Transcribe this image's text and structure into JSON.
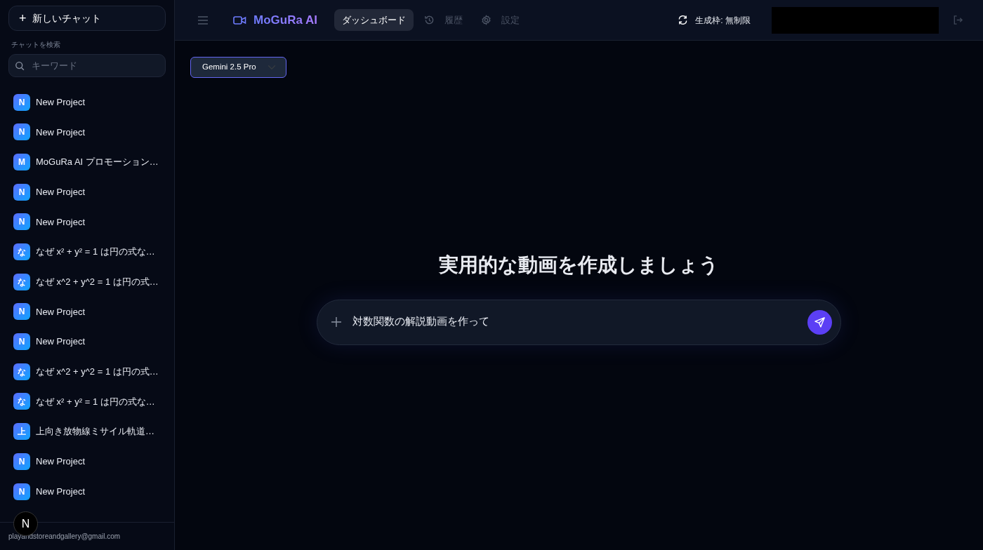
{
  "sidebar": {
    "new_chat_button": {
      "icon": "+",
      "label": "新しいチャット"
    },
    "search_label": "チャットを検索",
    "search": {
      "placeholder": "キーワード"
    },
    "chats": [
      {
        "initial": "N",
        "title": "New Project"
      },
      {
        "initial": "N",
        "title": "New Project"
      },
      {
        "initial": "M",
        "title": "MoGuRa AI プロモーション…"
      },
      {
        "initial": "N",
        "title": "New Project"
      },
      {
        "initial": "N",
        "title": "New Project"
      },
      {
        "initial": "な",
        "title": "なぜ x² + y² = 1 は円の式な…"
      },
      {
        "initial": "な",
        "title": "なぜ x^2 + y^2 = 1 は円の式…"
      },
      {
        "initial": "N",
        "title": "New Project"
      },
      {
        "initial": "N",
        "title": "New Project"
      },
      {
        "initial": "な",
        "title": "なぜ x^2 + y^2 = 1 は円の式…"
      },
      {
        "initial": "な",
        "title": "なぜ x² + y² = 1 は円の式な…"
      },
      {
        "initial": "上",
        "title": "上向き放物線ミサイル軌道…"
      },
      {
        "initial": "N",
        "title": "New Project"
      },
      {
        "initial": "N",
        "title": "New Project"
      }
    ],
    "dev_badge": "N",
    "email": "playandstoreandgallery@gmail.com"
  },
  "header": {
    "brand": "MoGuRa AI",
    "nav": [
      {
        "kind": "dashboard",
        "label": "ダッシュボード",
        "selected": true
      },
      {
        "kind": "history",
        "label": "履歴",
        "selected": false
      },
      {
        "kind": "settings",
        "label": "設定",
        "selected": false
      }
    ],
    "quota": "生成枠: 無制限"
  },
  "main": {
    "model_select": "Gemini 2.5 Pro",
    "heading": "実用的な動画を作成しましょう",
    "prompt": {
      "value": "対数関数の解説動画を作って"
    }
  }
}
